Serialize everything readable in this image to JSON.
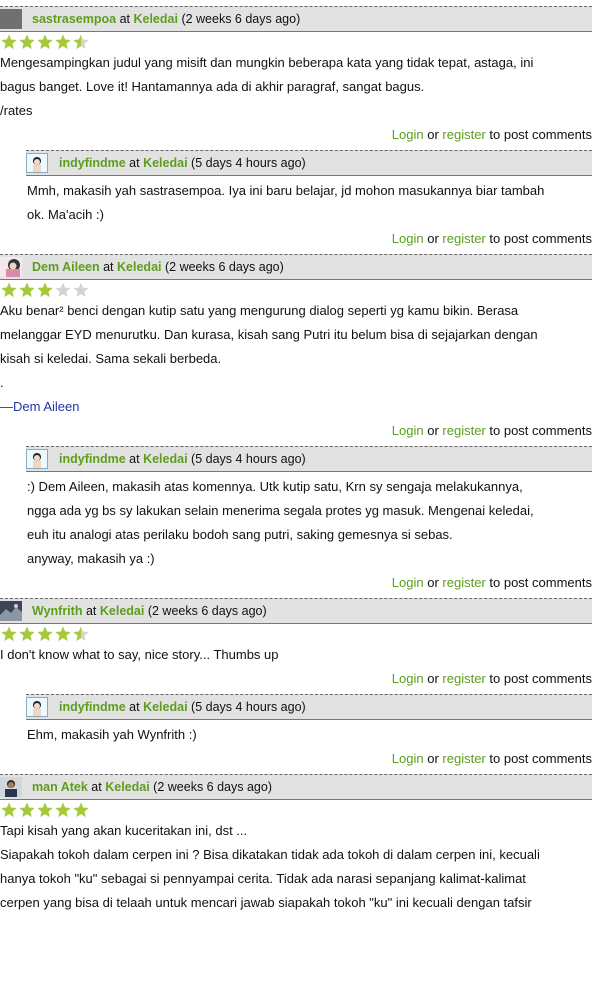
{
  "comments": [
    {
      "author": "sastrasempoa",
      "at": "at",
      "node": "Keledai",
      "time": "(2 weeks 6 days ago)",
      "rating": 4.5,
      "lines": [
        "Mengesampingkan judul yang misift dan mungkin beberapa kata yang tidak tepat, astaga, ini",
        "bagus banget. Love it! Hantamannya ada di akhir paragraf, sangat bagus.",
        "/rates"
      ]
    },
    {
      "author": "indyfindme",
      "at": "at",
      "node": "Keledai",
      "time": "(5 days 4 hours ago)",
      "lines": [
        "Mmh, makasih yah sastrasempoa. Iya ini baru belajar, jd mohon masukannya biar tambah",
        "ok. Ma'acih :)"
      ]
    },
    {
      "author": "Dem Aileen",
      "at": "at",
      "node": "Keledai",
      "time": "(2 weeks 6 days ago)",
      "rating": 3,
      "lines": [
        "Aku benar² benci dengan kutip satu yang mengurung dialog seperti yg kamu bikin. Berasa",
        "melanggar EYD menurutku. Dan kurasa, kisah sang Putri itu belum bisa di sejajarkan dengan",
        "kisah si keledai. Sama sekali berbeda.",
        "."
      ],
      "signature": "—Dem Aileen"
    },
    {
      "author": "indyfindme",
      "at": "at",
      "node": "Keledai",
      "time": "(5 days 4 hours ago)",
      "lines": [
        ":) Dem Aileen, makasih atas komennya. Utk kutip satu, Krn sy sengaja melakukannya,",
        "ngga ada yg bs sy lakukan selain menerima segala protes yg masuk. Mengenai keledai,",
        "euh itu analogi atas perilaku bodoh sang putri, saking gemesnya si sebas.",
        "anyway, makasih ya :)"
      ]
    },
    {
      "author": "Wynfrith",
      "at": "at",
      "node": "Keledai",
      "time": "(2 weeks 6 days ago)",
      "rating": 4.5,
      "lines": [
        "I don't know what to say, nice story... Thumbs up"
      ]
    },
    {
      "author": "indyfindme",
      "at": "at",
      "node": "Keledai",
      "time": "(5 days 4 hours ago)",
      "lines": [
        "Ehm, makasih yah Wynfrith :)"
      ]
    },
    {
      "author": "man Atek",
      "at": "at",
      "node": "Keledai",
      "time": "(2 weeks 6 days ago)",
      "rating": 5,
      "lines": [
        "Tapi kisah yang akan kuceritakan ini, dst ...",
        "Siapakah tokoh dalam cerpen ini ? Bisa dikatakan tidak ada tokoh di dalam cerpen ini, kecuali",
        "hanya tokoh \"ku\" sebagai si pennyampai cerita. Tidak ada narasi sepanjang kalimat-kalimat",
        "cerpen yang bisa di telaah untuk mencari jawab siapakah tokoh \"ku\" ini kecuali dengan tafsir"
      ]
    }
  ],
  "post_links": {
    "login": "Login",
    "or": "or",
    "register": "register",
    "suffix": "to post comments"
  },
  "colors": {
    "accent": "#5d9e1e",
    "star_on": "#a6c93a",
    "star_off": "#d4d4d4",
    "header_bg": "#e2e2e2"
  }
}
